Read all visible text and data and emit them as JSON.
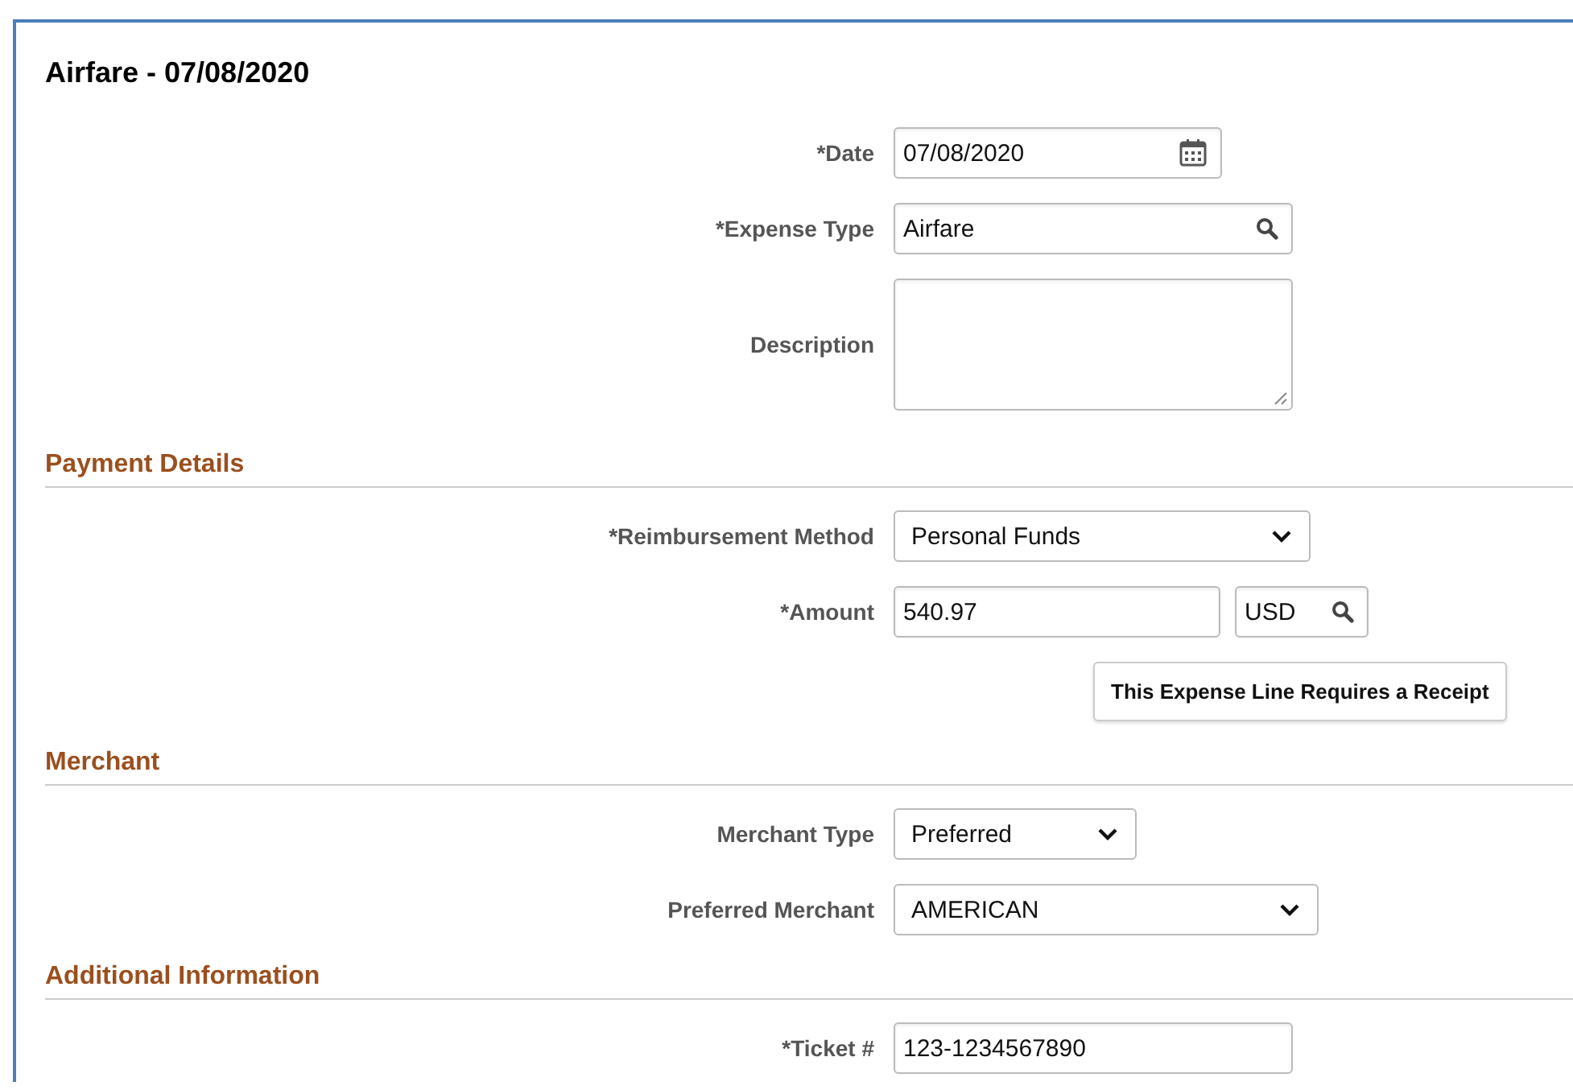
{
  "title": "Airfare - 07/08/2020",
  "top_fields": [
    {
      "kind": "date",
      "label": "*Date",
      "value": "07/08/2020"
    },
    {
      "kind": "lookup",
      "label": "*Expense Type",
      "value": "Airfare"
    },
    {
      "kind": "textarea",
      "label": "Description"
    }
  ],
  "sections": [
    {
      "heading": "Payment Details",
      "fields": [
        {
          "kind": "select",
          "label": "*Reimbursement Method",
          "value": "Personal Funds"
        },
        {
          "kind": "amount",
          "label": "*Amount",
          "value": "540.97",
          "currency": "USD"
        },
        {
          "kind": "button",
          "label": "This Expense Line Requires a Receipt"
        }
      ]
    },
    {
      "heading": "Merchant",
      "fields": [
        {
          "kind": "select",
          "label": "Merchant Type",
          "value": "Preferred"
        },
        {
          "kind": "select",
          "label": "Preferred Merchant",
          "value": "AMERICAN"
        }
      ]
    },
    {
      "heading": "Additional Information",
      "fields": [
        {
          "kind": "text",
          "label": "*Ticket #",
          "value": "123-1234567890"
        }
      ]
    }
  ]
}
